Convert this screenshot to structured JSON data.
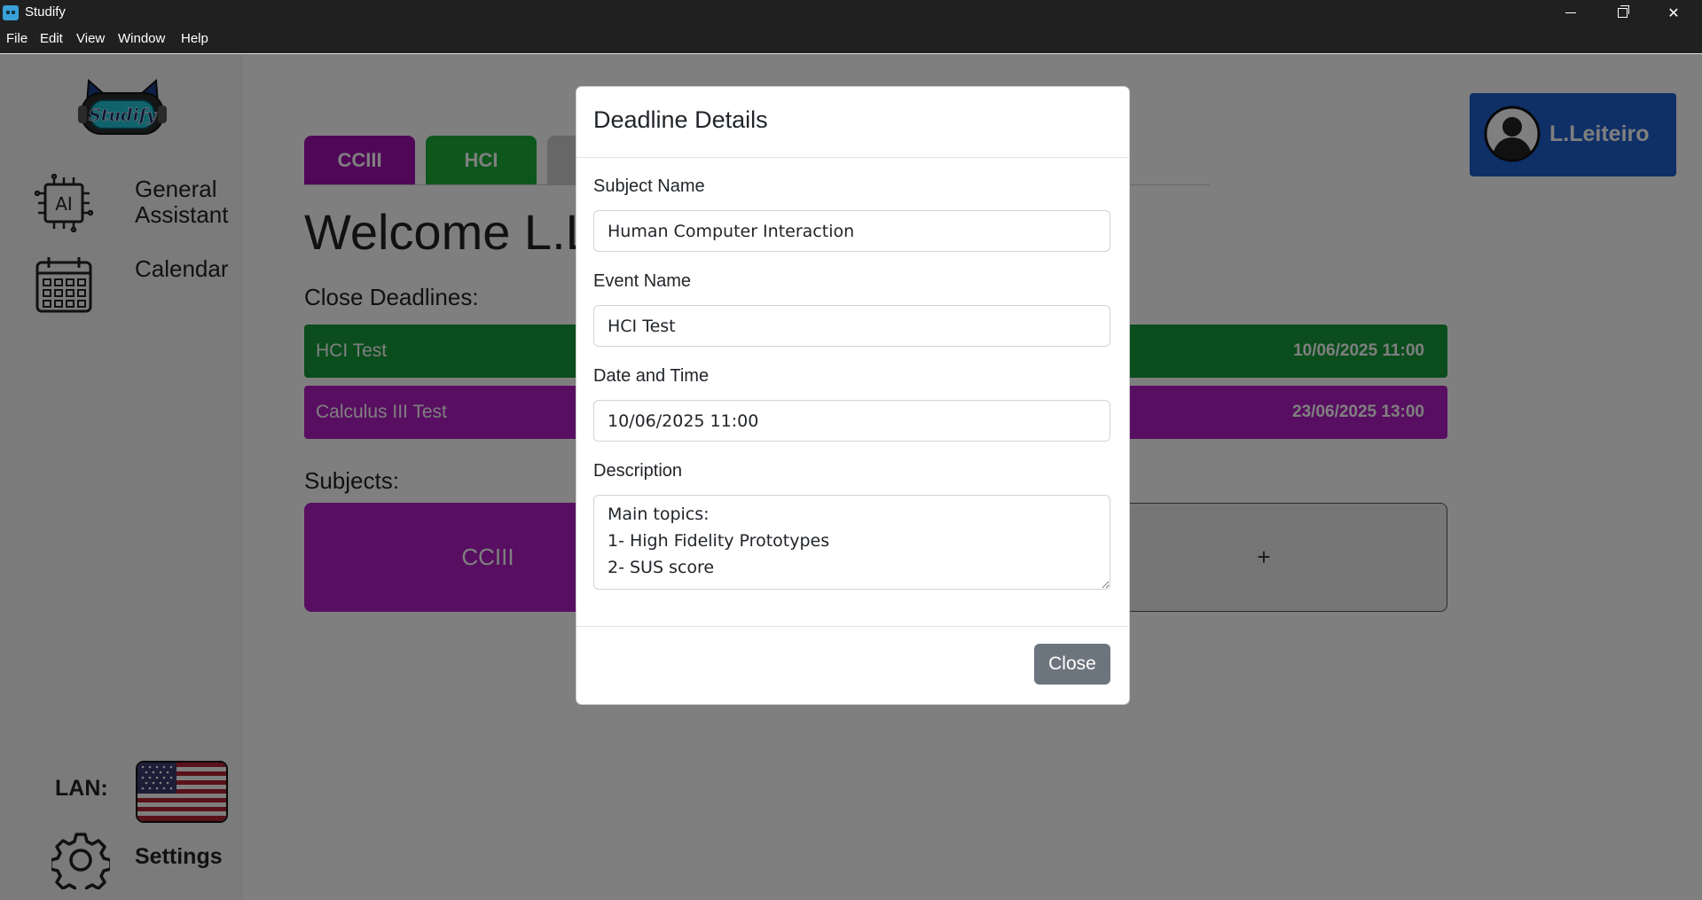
{
  "window": {
    "title": "Studify",
    "minimize": "—",
    "close": "✕"
  },
  "menu": [
    "File",
    "Edit",
    "View",
    "Window",
    "Help"
  ],
  "logo_text": "Studify",
  "sidebar": {
    "items": [
      {
        "label_line1": "General",
        "label_line2": "Assistant",
        "icon": "ai-chip-icon"
      },
      {
        "label": "Calendar",
        "icon": "calendar-icon"
      }
    ],
    "language_label": "LAN:",
    "language_icon": "us-flag-icon",
    "settings_label": "Settings",
    "settings_icon": "gear-icon"
  },
  "tabs": [
    {
      "label": "CCIII",
      "color": "#a10fb0"
    },
    {
      "label": "HCI",
      "color": "#1aae3a"
    }
  ],
  "welcome": "Welcome L.L",
  "close_deadlines_title": "Close Deadlines:",
  "deadlines": [
    {
      "name": "HCI Test",
      "date": "10/06/2025 11:00",
      "color": "#179a3a"
    },
    {
      "name": "Calculus III Test",
      "date": "23/06/2025 13:00",
      "color": "#b01fc3"
    }
  ],
  "subjects_title": "Subjects:",
  "subjects": [
    {
      "label": "CCIII",
      "color": "#b01fc3"
    },
    {
      "label": "+",
      "color": "#ededed"
    }
  ],
  "profile": {
    "name": "L.Leiteiro",
    "icon": "user-avatar-icon"
  },
  "modal": {
    "title": "Deadline Details",
    "subject_label": "Subject Name",
    "subject_value": "Human Computer Interaction",
    "event_label": "Event Name",
    "event_value": "HCI Test",
    "datetime_label": "Date and Time",
    "datetime_value": "10/06/2025 11:00",
    "description_label": "Description",
    "description_value": "Main topics:\n1- High Fidelity Prototypes\n2- SUS score",
    "close_label": "Close"
  },
  "colors": {
    "overlay": "rgba(0,0,0,0.5)",
    "profile": "#1f5fcf",
    "close_button": "#6c757d"
  }
}
